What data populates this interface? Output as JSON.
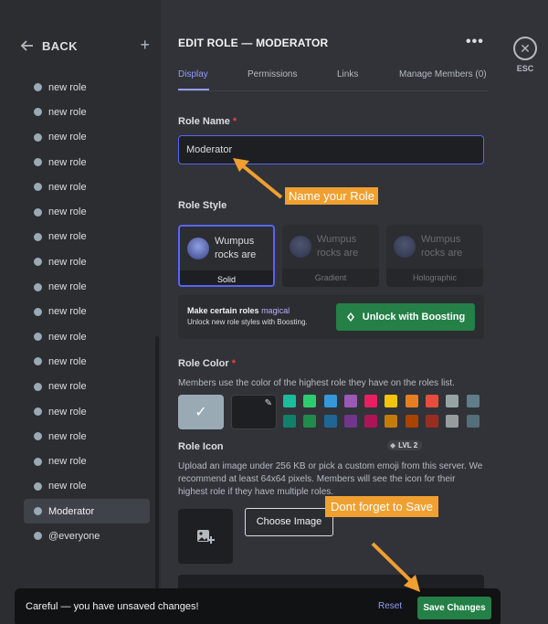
{
  "sidebar": {
    "back_label": "BACK",
    "add_icon": "plus-icon",
    "roles": [
      {
        "label": "new role",
        "selected": false
      },
      {
        "label": "new role",
        "selected": false
      },
      {
        "label": "new role",
        "selected": false
      },
      {
        "label": "new role",
        "selected": false
      },
      {
        "label": "new role",
        "selected": false
      },
      {
        "label": "new role",
        "selected": false
      },
      {
        "label": "new role",
        "selected": false
      },
      {
        "label": "new role",
        "selected": false
      },
      {
        "label": "new role",
        "selected": false
      },
      {
        "label": "new role",
        "selected": false
      },
      {
        "label": "new role",
        "selected": false
      },
      {
        "label": "new role",
        "selected": false
      },
      {
        "label": "new role",
        "selected": false
      },
      {
        "label": "new role",
        "selected": false
      },
      {
        "label": "new role",
        "selected": false
      },
      {
        "label": "new role",
        "selected": false
      },
      {
        "label": "new role",
        "selected": false
      },
      {
        "label": "Moderator",
        "selected": true
      },
      {
        "label": "@everyone",
        "selected": false
      }
    ]
  },
  "header": {
    "title": "EDIT ROLE — MODERATOR",
    "more_icon": "ellipsis-icon",
    "esc_label": "ESC"
  },
  "tabs": [
    {
      "label": "Display",
      "active": true
    },
    {
      "label": "Permissions",
      "active": false
    },
    {
      "label": "Links",
      "active": false
    },
    {
      "label": "Manage Members (0)",
      "active": false
    }
  ],
  "role_name": {
    "label": "Role Name",
    "required_mark": "*",
    "value": "Moderator"
  },
  "role_style": {
    "label": "Role Style",
    "preview_line1": "Wumpus",
    "preview_line2": "rocks are",
    "options": [
      {
        "label": "Solid",
        "selected": true
      },
      {
        "label": "Gradient",
        "selected": false
      },
      {
        "label": "Holographic",
        "selected": false
      }
    ]
  },
  "boost": {
    "title": "Make certain roles",
    "title_highlight": "magical",
    "subtitle": "Unlock new role styles with Boosting.",
    "button_label": "Unlock with Boosting"
  },
  "role_color": {
    "label": "Role Color",
    "required_mark": "*",
    "description": "Members use the color of the highest role they have on the roles list.",
    "default_color": "#99aab5",
    "swatches": [
      "#1abc9c",
      "#2ecc71",
      "#3498db",
      "#9b59b6",
      "#e91e63",
      "#f1c40f",
      "#e67e22",
      "#e74c3c",
      "#95a5a6",
      "#607d8b",
      "#11806a",
      "#1f8b4c",
      "#206694",
      "#71368a",
      "#ad1457",
      "#c27c0e",
      "#a84300",
      "#992d22",
      "#979c9f",
      "#546e7a"
    ]
  },
  "role_icon": {
    "label": "Role Icon",
    "level_badge": "LVL 2",
    "description": "Upload an image under 256 KB or pick a custom emoji from this server. We recommend at least 64x64 pixels. Members will see the icon for their highest role if they have multiple roles.",
    "choose_button": "Choose Image"
  },
  "notice": {
    "text": "Careful — you have unsaved changes!",
    "reset_label": "Reset",
    "save_label": "Save Changes"
  },
  "annotations": {
    "name_callout": "Name your Role",
    "save_callout": "Dont forget to Save",
    "callout_color": "#f0a030"
  },
  "colors": {
    "accent": "#5865f2",
    "success": "#248046",
    "background": "#313338",
    "sidebar": "#2b2d31"
  }
}
